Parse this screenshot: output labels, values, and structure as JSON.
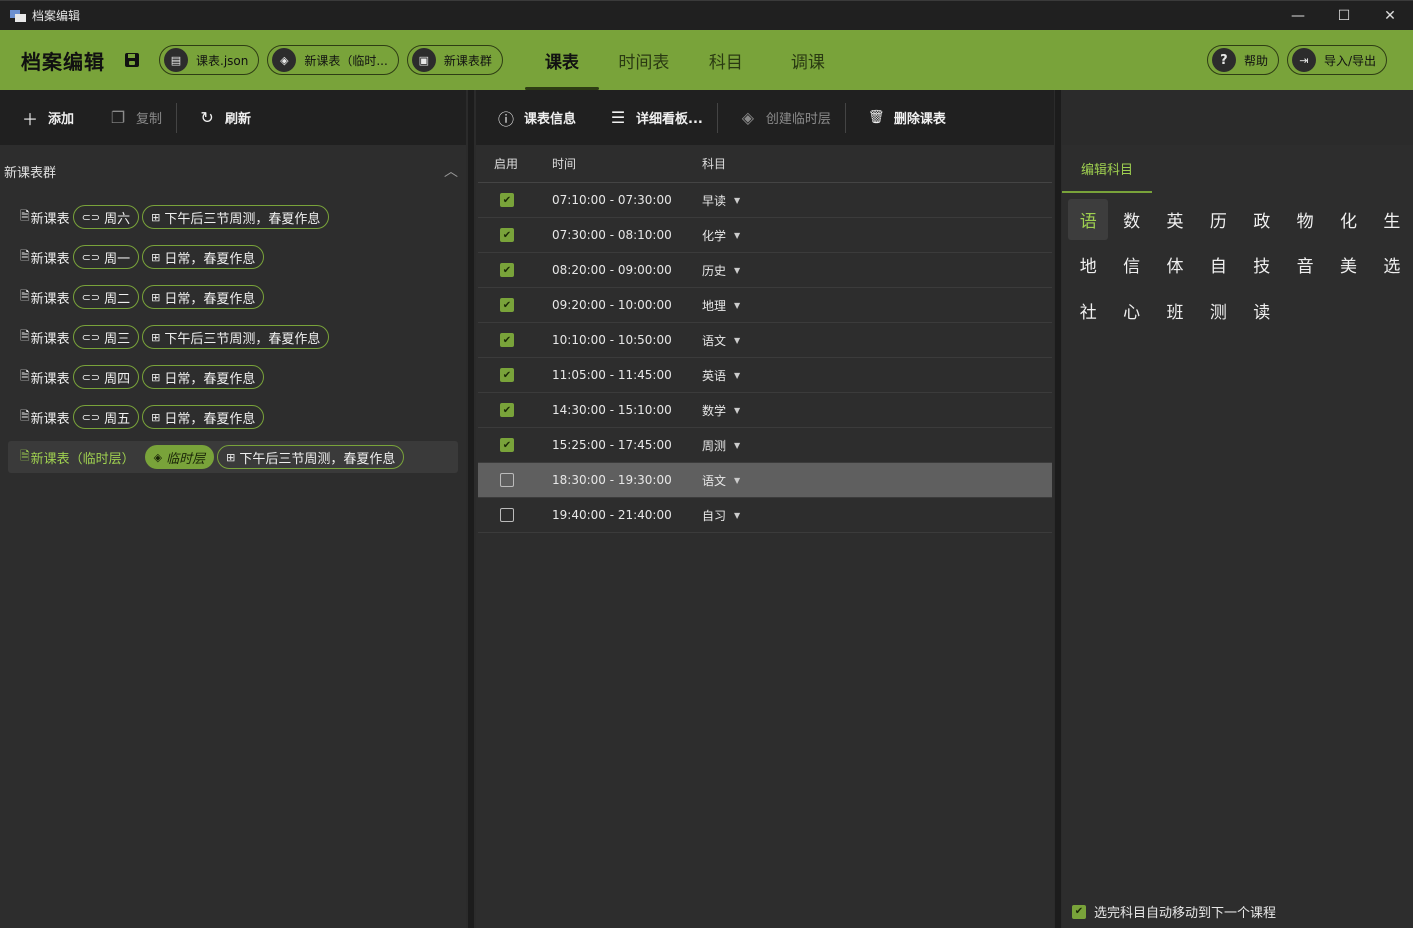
{
  "window": {
    "title": "档案编辑",
    "controls": {
      "minimize": "—",
      "maximize": "☐",
      "close": "✕"
    }
  },
  "header": {
    "title": "档案编辑",
    "pills": [
      {
        "icon": "▤",
        "label": "课表.json"
      },
      {
        "icon": "◈",
        "label": "新课表（临时..."
      },
      {
        "icon": "▣",
        "label": "新课表群"
      }
    ],
    "tabs": [
      "课表",
      "时间表",
      "科目",
      "调课"
    ],
    "active_tab": "课表",
    "help_label": "帮助",
    "help_icon": "?",
    "import_export_label": "导入/导出",
    "import_export_icon": "⇥"
  },
  "left_toolbar": {
    "add": {
      "icon": "＋",
      "label": "添加"
    },
    "copy": {
      "icon": "❐",
      "label": "复制"
    },
    "refresh": {
      "icon": "↻",
      "label": "刷新"
    }
  },
  "left_list": {
    "group_name": "新课表群",
    "items": [
      {
        "name": "新课表",
        "day": "周六",
        "tag": "下午后三节周测，春夏作息"
      },
      {
        "name": "新课表",
        "day": "周一",
        "tag": "日常，春夏作息"
      },
      {
        "name": "新课表",
        "day": "周二",
        "tag": "日常，春夏作息"
      },
      {
        "name": "新课表",
        "day": "周三",
        "tag": "下午后三节周测，春夏作息"
      },
      {
        "name": "新课表",
        "day": "周四",
        "tag": "日常，春夏作息"
      },
      {
        "name": "新课表",
        "day": "周五",
        "tag": "日常，春夏作息"
      }
    ],
    "selected_item": {
      "name": "新课表（临时层）",
      "layer": "临时层",
      "tag": "下午后三节周测，春夏作息"
    }
  },
  "mid_toolbar": {
    "info": {
      "icon": "ⓘ",
      "label": "课表信息"
    },
    "board": {
      "icon": "☰",
      "label": "详细看板..."
    },
    "temp_layer": {
      "icon": "◈",
      "label": "创建临时层"
    },
    "delete": {
      "icon": "🗑",
      "label": "删除课表"
    }
  },
  "table": {
    "headers": {
      "enabled": "启用",
      "time": "时间",
      "subject": "科目"
    },
    "rows": [
      {
        "enabled": true,
        "time": "07:10:00 - 07:30:00",
        "subject": "早读"
      },
      {
        "enabled": true,
        "time": "07:30:00 - 08:10:00",
        "subject": "化学"
      },
      {
        "enabled": true,
        "time": "08:20:00 - 09:00:00",
        "subject": "历史"
      },
      {
        "enabled": true,
        "time": "09:20:00 - 10:00:00",
        "subject": "地理"
      },
      {
        "enabled": true,
        "time": "10:10:00 - 10:50:00",
        "subject": "语文"
      },
      {
        "enabled": true,
        "time": "11:05:00 - 11:45:00",
        "subject": "英语"
      },
      {
        "enabled": true,
        "time": "14:30:00 - 15:10:00",
        "subject": "数学"
      },
      {
        "enabled": true,
        "time": "15:25:00 - 17:45:00",
        "subject": "周测"
      },
      {
        "enabled": false,
        "time": "18:30:00 - 19:30:00",
        "subject": "语文",
        "selected": true
      },
      {
        "enabled": false,
        "time": "19:40:00 - 21:40:00",
        "subject": "自习"
      }
    ]
  },
  "right_panel": {
    "tab": "编辑科目",
    "subjects": [
      "语",
      "数",
      "英",
      "历",
      "政",
      "物",
      "化",
      "生",
      "地",
      "信",
      "体",
      "自",
      "技",
      "音",
      "美",
      "选",
      "社",
      "心",
      "班",
      "测",
      "读"
    ],
    "active_subject": "语",
    "auto_move_label": "选完科目自动移动到下一个课程",
    "auto_move_checked": true
  },
  "colors": {
    "accent": "#79a33a",
    "accent_text": "#9fd050",
    "panel_dark": "#202020",
    "panel": "#2d2d2d"
  }
}
